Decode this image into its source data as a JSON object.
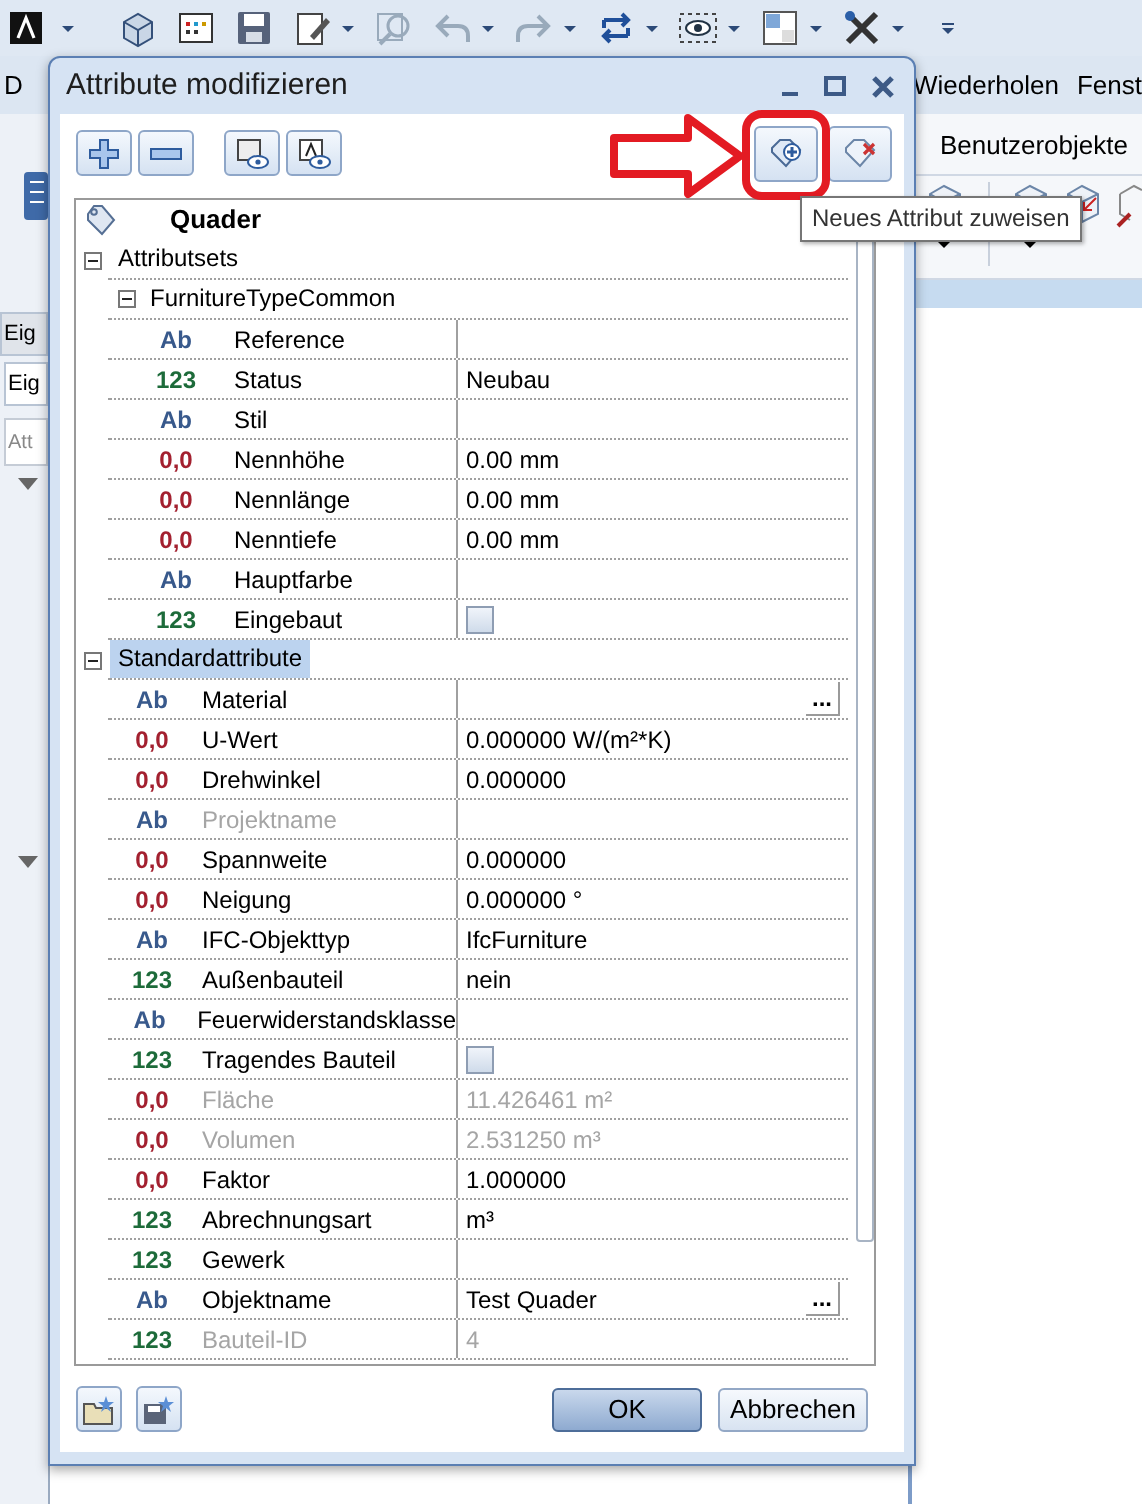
{
  "app": {
    "menu": [
      "D",
      "Wiederholen",
      "Fenst"
    ],
    "ribbon_tab": "Benutzerobjekte",
    "side_tabs": [
      {
        "label": "Eig",
        "selected": false
      },
      {
        "label": "Eig",
        "selected": true
      }
    ],
    "side_search": {
      "placeholder": "Att"
    }
  },
  "dialog": {
    "title": "Attribute modifizieren",
    "tooltip": "Neues Attribut zuweisen",
    "tree": {
      "root": "Quader",
      "children": [
        {
          "kind": "group",
          "label": "Attributsets",
          "expanded": true,
          "selected": false,
          "children": [
            {
              "kind": "group",
              "label": "FurnitureTypeCommon",
              "expanded": true,
              "selected": false,
              "children": [
                {
                  "kind": "attribute",
                  "color": "#38598c",
                  "badge": "Ab",
                  "name": "Reference",
                  "disabled": false
                },
                {
                  "kind": "attribute",
                  "color": "#1d6b3a",
                  "badge": "123",
                  "name": "Status",
                  "value": "Neubau",
                  "disabled": false
                },
                {
                  "kind": "attribute",
                  "color": "#38598c",
                  "badge": "Ab",
                  "name": "Stil",
                  "disabled": false
                },
                {
                  "kind": "attribute",
                  "color": "#a3202f",
                  "badge": "0,0",
                  "name": "Nennhöhe",
                  "value": "0.00 mm",
                  "disabled": false
                },
                {
                  "kind": "attribute",
                  "color": "#a3202f",
                  "badge": "0,0",
                  "name": "Nennlänge",
                  "value": "0.00 mm",
                  "disabled": false
                },
                {
                  "kind": "attribute",
                  "color": "#a3202f",
                  "badge": "0,0",
                  "name": "Nenntiefe",
                  "value": "0.00 mm",
                  "disabled": false
                },
                {
                  "kind": "attribute",
                  "color": "#38598c",
                  "badge": "Ab",
                  "name": "Hauptfarbe",
                  "disabled": false
                },
                {
                  "kind": "attribute",
                  "color": "#1d6b3a",
                  "badge": "123",
                  "name": "Eingebaut",
                  "checked": false,
                  "disabled": false
                }
              ]
            }
          ]
        },
        {
          "kind": "group",
          "label": "Standardattribute",
          "expanded": true,
          "selected": true,
          "children": [
            {
              "kind": "attribute",
              "color": "#38598c",
              "badge": "Ab",
              "name": "Material",
              "button": "...",
              "disabled": false
            },
            {
              "kind": "attribute",
              "color": "#a3202f",
              "badge": "0,0",
              "name": "U-Wert",
              "value": "0.000000 W/(m²*K)",
              "disabled": false
            },
            {
              "kind": "attribute",
              "color": "#a3202f",
              "badge": "0,0",
              "name": "Drehwinkel",
              "value": "0.000000",
              "disabled": false
            },
            {
              "kind": "attribute",
              "color": "#38598c",
              "badge": "Ab",
              "name": "Projektname",
              "disabled": true
            },
            {
              "kind": "attribute",
              "color": "#a3202f",
              "badge": "0,0",
              "name": "Spannweite",
              "value": "0.000000",
              "disabled": false
            },
            {
              "kind": "attribute",
              "color": "#a3202f",
              "badge": "0,0",
              "name": "Neigung",
              "value": "0.000000 °",
              "disabled": false
            },
            {
              "kind": "attribute",
              "color": "#38598c",
              "badge": "Ab",
              "name": "IFC-Objekttyp",
              "value": "IfcFurniture",
              "disabled": false
            },
            {
              "kind": "attribute",
              "color": "#1d6b3a",
              "badge": "123",
              "name": "Außenbauteil",
              "value": "nein",
              "disabled": false
            },
            {
              "kind": "attribute",
              "color": "#38598c",
              "badge": "Ab",
              "name": "Feuerwiderstandsklasse",
              "disabled": false
            },
            {
              "kind": "attribute",
              "color": "#1d6b3a",
              "badge": "123",
              "name": "Tragendes Bauteil",
              "checked": false,
              "disabled": false
            },
            {
              "kind": "attribute",
              "color": "#a3202f",
              "badge": "0,0",
              "name": "Fläche",
              "value": "11.426461 m²",
              "disabled": true
            },
            {
              "kind": "attribute",
              "color": "#a3202f",
              "badge": "0,0",
              "name": "Volumen",
              "value": "2.531250 m³",
              "disabled": true
            },
            {
              "kind": "attribute",
              "color": "#a3202f",
              "badge": "0,0",
              "name": "Faktor",
              "value": "1.000000",
              "disabled": false
            },
            {
              "kind": "attribute",
              "color": "#1d6b3a",
              "badge": "123",
              "name": "Abrechnungsart",
              "value": "m³",
              "disabled": false
            },
            {
              "kind": "attribute",
              "color": "#1d6b3a",
              "badge": "123",
              "name": "Gewerk",
              "disabled": false
            },
            {
              "kind": "attribute",
              "color": "#38598c",
              "badge": "Ab",
              "name": "Objektname",
              "value": "Test Quader",
              "button": "...",
              "disabled": false
            },
            {
              "kind": "attribute",
              "color": "#1d6b3a",
              "badge": "123",
              "name": "Bauteil-ID",
              "value": "4",
              "disabled": true
            }
          ]
        }
      ]
    },
    "buttons": [
      {
        "label": "OK",
        "default": true
      },
      {
        "label": "Abbrechen",
        "default": false
      }
    ]
  }
}
